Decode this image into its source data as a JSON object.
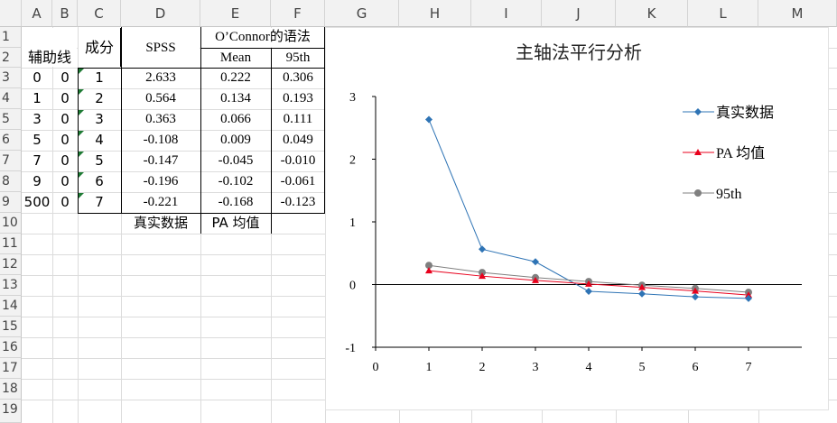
{
  "columns": [
    "A",
    "B",
    "C",
    "D",
    "E",
    "F",
    "G",
    "H",
    "I",
    "J",
    "K",
    "L",
    "M"
  ],
  "rows": [
    "1",
    "2",
    "3",
    "4",
    "5",
    "6",
    "7",
    "8",
    "9",
    "10",
    "11",
    "12",
    "13",
    "14",
    "15",
    "16",
    "17",
    "18",
    "19"
  ],
  "table": {
    "aux_label": "辅助线",
    "component_label": "成分",
    "spss_label": "SPSS",
    "oconnor_label": "O’Connor的语法",
    "mean_label": "Mean",
    "p95_label": "95th",
    "aux_a": [
      "0",
      "1",
      "3",
      "5",
      "7",
      "9",
      "500"
    ],
    "aux_b": [
      "0",
      "0",
      "0",
      "0",
      "0",
      "0",
      "0"
    ],
    "components": [
      "1",
      "2",
      "3",
      "4",
      "5",
      "6",
      "7"
    ],
    "spss": [
      "2.633",
      "0.564",
      "0.363",
      "-0.108",
      "-0.147",
      "-0.196",
      "-0.221"
    ],
    "mean": [
      "0.222",
      "0.134",
      "0.066",
      "0.009",
      "-0.045",
      "-0.102",
      "-0.168"
    ],
    "p95": [
      "0.306",
      "0.193",
      "0.111",
      "0.049",
      "-0.010",
      "-0.061",
      "-0.123"
    ],
    "note_d10": "真实数据",
    "note_e10": "PA 均值"
  },
  "chart_data": {
    "type": "line",
    "title": "主轴法平行分析",
    "x": [
      1,
      2,
      3,
      4,
      5,
      6,
      7
    ],
    "xlim": [
      0,
      8
    ],
    "ylim": [
      -1,
      3
    ],
    "xticks": [
      "0",
      "1",
      "2",
      "3",
      "4",
      "5",
      "6",
      "7"
    ],
    "yticks": [
      "3",
      "2",
      "1",
      "0",
      "-1"
    ],
    "legend_position": "top-right",
    "series": [
      {
        "name": "真实数据",
        "values": [
          2.633,
          0.564,
          0.363,
          -0.108,
          -0.147,
          -0.196,
          -0.221
        ],
        "color": "#2f74b5",
        "marker": "diamond"
      },
      {
        "name": "PA 均值",
        "values": [
          0.222,
          0.134,
          0.066,
          0.009,
          -0.045,
          -0.102,
          -0.168
        ],
        "color": "#e8001c",
        "marker": "triangle"
      },
      {
        "name": "95th",
        "values": [
          0.306,
          0.193,
          0.111,
          0.049,
          -0.01,
          -0.061,
          -0.123
        ],
        "color": "#7f7f7f",
        "marker": "circle"
      }
    ]
  }
}
